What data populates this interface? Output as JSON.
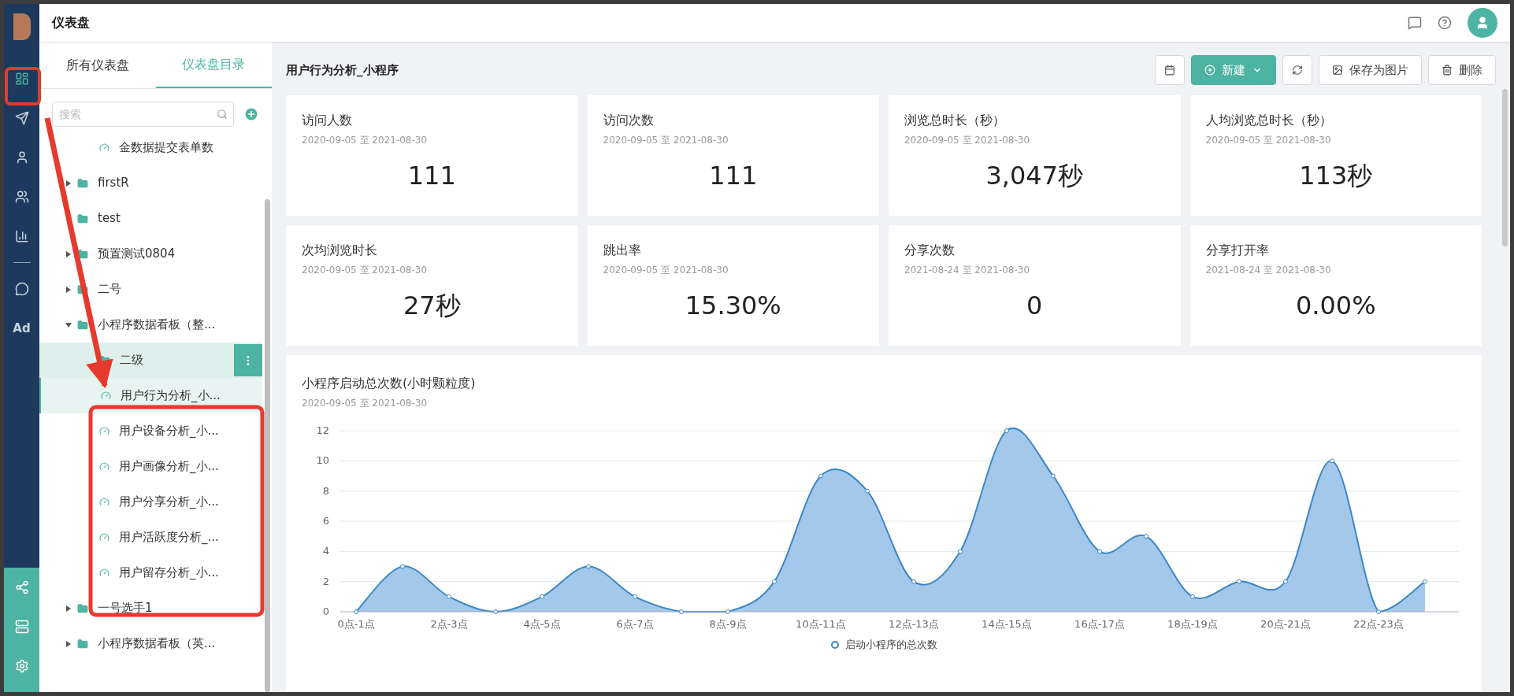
{
  "nav": {
    "items": [
      {
        "selected": true
      },
      {
        "selected": false
      },
      {
        "selected": false
      },
      {
        "selected": false
      },
      {
        "selected": false
      },
      {
        "selected": false
      },
      {
        "label": "Ad",
        "selected": false
      }
    ]
  },
  "topbar": {
    "title": "仪表盘"
  },
  "sidebar": {
    "tabs": [
      {
        "label": "所有仪表盘",
        "selected": false
      },
      {
        "label": "仪表盘目录",
        "selected": true
      }
    ],
    "search": {
      "placeholder": "搜索"
    },
    "tree": [
      {
        "kind": "dashboard",
        "label": "金数据提交表单数",
        "selected": false,
        "hovered": false
      },
      {
        "kind": "folder",
        "label": "firstR",
        "expanded": false,
        "selected": false,
        "hovered": false
      },
      {
        "kind": "folder",
        "label": "test",
        "selected": false,
        "hovered": false
      },
      {
        "kind": "folder",
        "label": "预置测试0804",
        "expanded": false,
        "selected": false,
        "hovered": false
      },
      {
        "kind": "folder",
        "label": "二号",
        "expanded": false,
        "selected": false,
        "hovered": false
      },
      {
        "kind": "folder",
        "label": "小程序数据看板（整...",
        "expanded": true,
        "selected": false,
        "hovered": false,
        "children": [
          {
            "kind": "folder",
            "label": "二级",
            "selected": false,
            "hovered": true
          },
          {
            "kind": "dashboard",
            "label": "用户行为分析_小...",
            "selected": true,
            "hovered": false
          },
          {
            "kind": "dashboard",
            "label": "用户设备分析_小...",
            "selected": false,
            "hovered": false
          },
          {
            "kind": "dashboard",
            "label": "用户画像分析_小...",
            "selected": false,
            "hovered": false
          },
          {
            "kind": "dashboard",
            "label": "用户分享分析_小...",
            "selected": false,
            "hovered": false
          },
          {
            "kind": "dashboard",
            "label": "用户活跃度分析_...",
            "selected": false,
            "hovered": false
          },
          {
            "kind": "dashboard",
            "label": "用户留存分析_小...",
            "selected": false,
            "hovered": false
          }
        ]
      },
      {
        "kind": "folder",
        "label": "一号选手1",
        "expanded": false,
        "selected": false,
        "hovered": false
      },
      {
        "kind": "folder",
        "label": "小程序数据看板（英...",
        "expanded": false,
        "selected": false,
        "hovered": false
      }
    ]
  },
  "main": {
    "title": "用户行为分析_小程序",
    "toolbar": [
      {
        "kind": "icon"
      },
      {
        "kind": "primary",
        "label": "新建"
      },
      {
        "kind": "icon"
      },
      {
        "kind": "default",
        "label": "保存为图片"
      },
      {
        "kind": "default",
        "label": "删除"
      }
    ],
    "cards": [
      {
        "title": "访问人数",
        "range": "2020-09-05 至 2021-08-30",
        "value": "111"
      },
      {
        "title": "访问次数",
        "range": "2020-09-05 至 2021-08-30",
        "value": "111"
      },
      {
        "title": "浏览总时长（秒）",
        "range": "2020-09-05 至 2021-08-30",
        "value": "3,047秒"
      },
      {
        "title": "人均浏览总时长（秒）",
        "range": "2020-09-05 至 2021-08-30",
        "value": "113秒"
      },
      {
        "title": "次均浏览时长",
        "range": "2020-09-05 至 2021-08-30",
        "value": "27秒"
      },
      {
        "title": "跳出率",
        "range": "2020-09-05 至 2021-08-30",
        "value": "15.30%"
      },
      {
        "title": "分享次数",
        "range": "2021-08-24 至 2021-08-30",
        "value": "0"
      },
      {
        "title": "分享打开率",
        "range": "2021-08-24 至 2021-08-30",
        "value": "0.00%"
      }
    ],
    "chart": {
      "title": "小程序启动总次数(小时颗粒度)",
      "range": "2020-09-05 至 2021-08-30",
      "chart_data": {
        "type": "area",
        "categories": [
          "0点-1点",
          null,
          "2点-3点",
          null,
          "4点-5点",
          null,
          "6点-7点",
          null,
          "8点-9点",
          null,
          "10点-11点",
          null,
          "12点-13点",
          null,
          "14点-15点",
          null,
          "16点-17点",
          null,
          "18点-19点",
          null,
          "20点-21点",
          null,
          "22点-23点",
          null
        ],
        "grid": true,
        "series": [
          {
            "name": "启动小程序的总次数",
            "color": "#3a87c8",
            "values": [
              0,
              3,
              1,
              0,
              1,
              3,
              1,
              0,
              0,
              2,
              9,
              8,
              2,
              4,
              12,
              9,
              4,
              5,
              1,
              2,
              2,
              10,
              0,
              2
            ]
          }
        ],
        "ylim": [
          0,
          12
        ],
        "yticks": [
          0,
          2,
          4,
          6,
          8,
          10,
          12
        ]
      }
    }
  }
}
